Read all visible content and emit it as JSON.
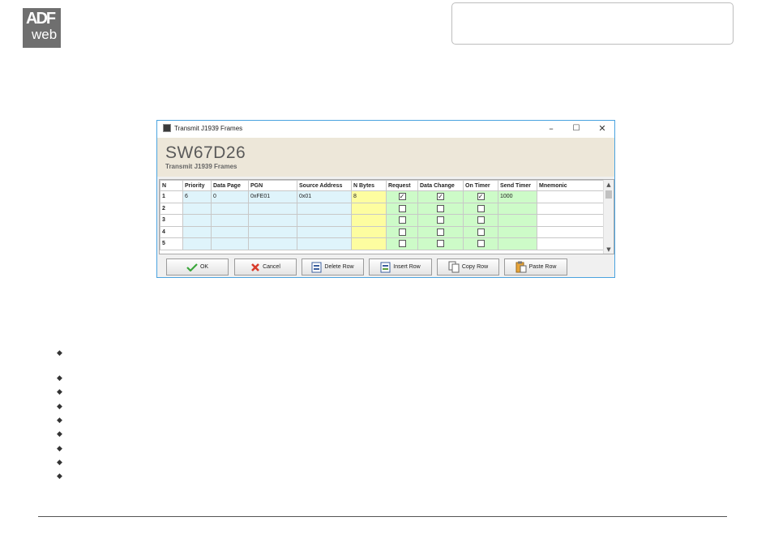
{
  "logo": {
    "line1": "ADF",
    "line2": "web"
  },
  "window": {
    "title": "Transmit J1939 Frames",
    "heading": "SW67D26",
    "subheading": "Transmit J1939 Frames",
    "controls": {
      "minimize": "–",
      "maximize": "☐",
      "close": "✕"
    }
  },
  "table": {
    "headers": [
      "N",
      "Priority",
      "Data Page",
      "PGN",
      "Source Address",
      "N Bytes",
      "Request",
      "Data Change",
      "On Timer",
      "Send Timer",
      "Mnemonic"
    ],
    "rows": [
      {
        "n": "1",
        "priority": "6",
        "data_page": "0",
        "pgn": "0xFE01",
        "source_address": "0x01",
        "n_bytes": "8",
        "request": true,
        "data_change": true,
        "on_timer": true,
        "send_timer": "1000",
        "mnemonic": ""
      },
      {
        "n": "2",
        "priority": "",
        "data_page": "",
        "pgn": "",
        "source_address": "",
        "n_bytes": "",
        "request": false,
        "data_change": false,
        "on_timer": false,
        "send_timer": "",
        "mnemonic": ""
      },
      {
        "n": "3",
        "priority": "",
        "data_page": "",
        "pgn": "",
        "source_address": "",
        "n_bytes": "",
        "request": false,
        "data_change": false,
        "on_timer": false,
        "send_timer": "",
        "mnemonic": ""
      },
      {
        "n": "4",
        "priority": "",
        "data_page": "",
        "pgn": "",
        "source_address": "",
        "n_bytes": "",
        "request": false,
        "data_change": false,
        "on_timer": false,
        "send_timer": "",
        "mnemonic": ""
      },
      {
        "n": "5",
        "priority": "",
        "data_page": "",
        "pgn": "",
        "source_address": "",
        "n_bytes": "",
        "request": false,
        "data_change": false,
        "on_timer": false,
        "send_timer": "",
        "mnemonic": ""
      }
    ]
  },
  "buttons": {
    "ok": "OK",
    "cancel": "Cancel",
    "delete_row": "Delete Row",
    "insert_row": "Insert Row",
    "copy_row": "Copy Row",
    "paste_row": "Paste Row"
  },
  "colors": {
    "blue_cells": "#dff4fb",
    "yellow_cells": "#fdfda0",
    "green_cells": "#cdfbc8",
    "header_band": "#ede7d9",
    "window_border": "#4aa3df"
  }
}
